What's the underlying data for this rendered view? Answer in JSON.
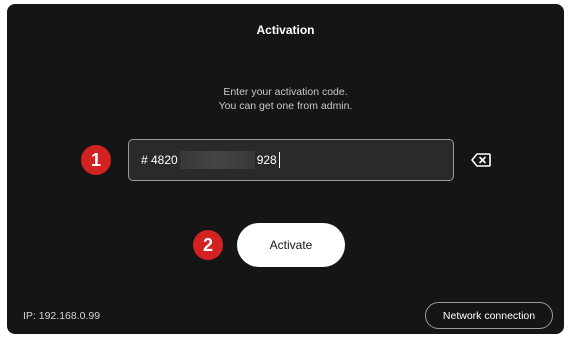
{
  "header": {
    "title": "Activation"
  },
  "instructions": {
    "line1": "Enter your activation code.",
    "line2": "You can get one from admin."
  },
  "activation_code": {
    "prefix": "# 4820",
    "suffix": "928"
  },
  "icons": {
    "clear": "backspace-clear-icon"
  },
  "markers": {
    "step1": "1",
    "step2": "2"
  },
  "actions": {
    "activate_label": "Activate"
  },
  "footer": {
    "ip_text": "IP: 192.168.0.99",
    "network_label": "Network connection"
  },
  "colors": {
    "background": "#151515",
    "marker": "#d32222",
    "button": "#ffffff"
  }
}
